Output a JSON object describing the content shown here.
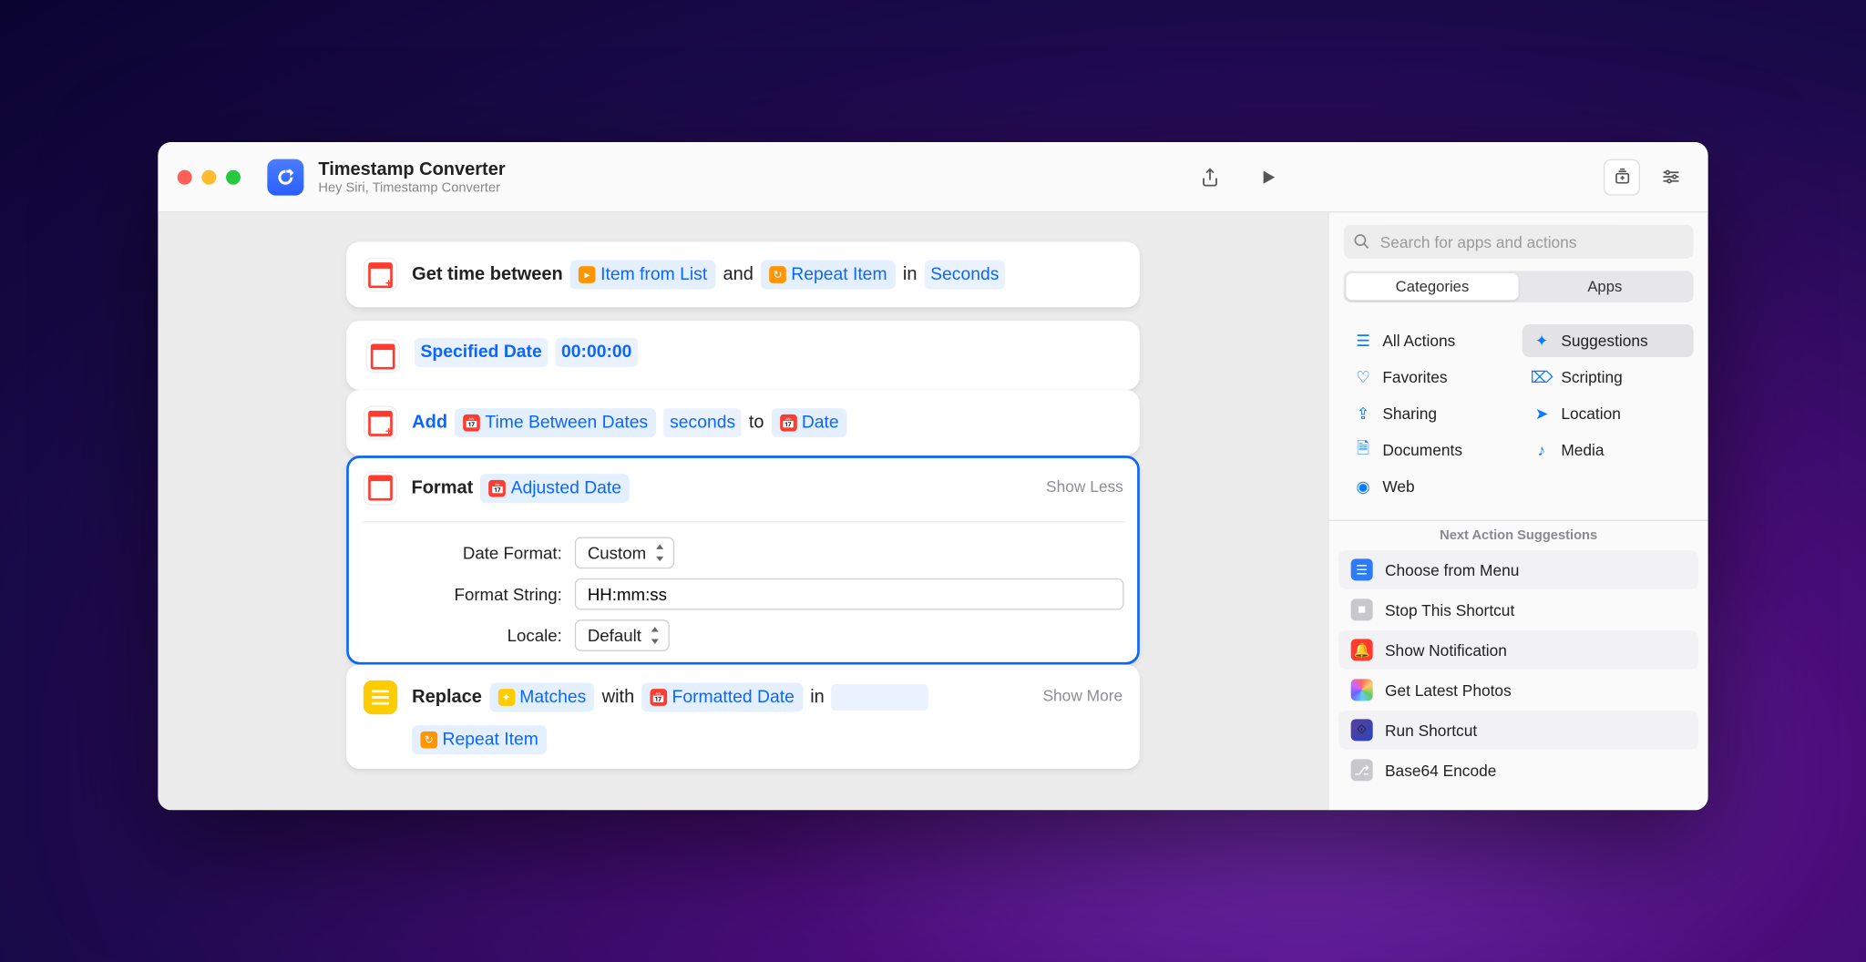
{
  "header": {
    "title": "Timestamp Converter",
    "subtitle": "Hey Siri, Timestamp Converter"
  },
  "sidebar": {
    "search_placeholder": "Search for apps and actions",
    "tabs": {
      "categories": "Categories",
      "apps": "Apps"
    },
    "categories": [
      {
        "label": "All Actions",
        "icon": "list"
      },
      {
        "label": "Suggestions",
        "icon": "sparkle"
      },
      {
        "label": "Favorites",
        "icon": "heart"
      },
      {
        "label": "Scripting",
        "icon": "tag"
      },
      {
        "label": "Sharing",
        "icon": "share"
      },
      {
        "label": "Location",
        "icon": "nav"
      },
      {
        "label": "Documents",
        "icon": "doc"
      },
      {
        "label": "Media",
        "icon": "music"
      },
      {
        "label": "Web",
        "icon": "globe"
      }
    ],
    "next_header": "Next Action Suggestions",
    "suggestions": [
      {
        "label": "Choose from Menu",
        "cls": "blue"
      },
      {
        "label": "Stop This Shortcut",
        "cls": "gray"
      },
      {
        "label": "Show Notification",
        "cls": "red"
      },
      {
        "label": "Get Latest Photos",
        "cls": "photos"
      },
      {
        "label": "Run Shortcut",
        "cls": "purple"
      },
      {
        "label": "Base64 Encode",
        "cls": "gray"
      }
    ]
  },
  "actions": {
    "a1": {
      "verb": "Get time between",
      "p1": "Item from List",
      "mid1": "and",
      "p2": "Repeat Item",
      "mid2": "in",
      "unit": "Seconds"
    },
    "a2": {
      "label": "Specified Date",
      "time": "00:00:00"
    },
    "a3": {
      "verb": "Add",
      "amount": "Time Between Dates",
      "unit": "seconds",
      "to": "to",
      "target": "Date"
    },
    "a4": {
      "verb": "Format",
      "input": "Adjusted Date",
      "toggle": "Show Less",
      "rows": {
        "date_format_label": "Date Format:",
        "date_format_value": "Custom",
        "format_string_label": "Format String:",
        "format_string_value": "HH:mm:ss",
        "locale_label": "Locale:",
        "locale_value": "Default"
      }
    },
    "a5": {
      "verb": "Replace",
      "find": "Matches",
      "with": "with",
      "repl": "Formatted Date",
      "in": "in",
      "source": "Repeat Item",
      "toggle": "Show More"
    }
  }
}
